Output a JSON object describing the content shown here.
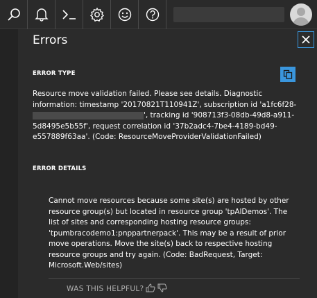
{
  "toolbar": {
    "icons": [
      "search-icon",
      "bell-icon",
      "cloud-shell-icon",
      "gear-icon",
      "smiley-icon",
      "help-icon"
    ],
    "account_redacted": true
  },
  "panel": {
    "title": "Errors",
    "error_type_heading": "ERROR TYPE",
    "error_type_part1": "Resource move validation failed. Please see details. Diagnostic information: timestamp '20170821T110941Z', subscription id 'a1fc6f28-",
    "error_type_part2": "', tracking id '908713f3-08db-49d8-a911-5d8495e5b55f', request correlation id '37b2adc4-7be4-4189-bd49-e557889f63aa'. (Code: ResourceMoveProviderValidationFailed)",
    "error_details_heading": "ERROR DETAILS",
    "error_details_text": "Cannot move resources because some site(s) are hosted by other resource group(s) but located in resource group 'tpAlDemos'. The list of sites and corresponding hosting resource groups: 'tpumbracodemo1:pnppartnerpack'. This may be a result of prior move operations. Move the site(s) back to respective hosting resource groups and try again. (Code: BadRequest, Target: Microsoft.Web/sites)",
    "helpful_label": "WAS THIS HELPFUL?"
  },
  "colors": {
    "accent": "#3a96dd",
    "background": "#2b2b2b"
  }
}
